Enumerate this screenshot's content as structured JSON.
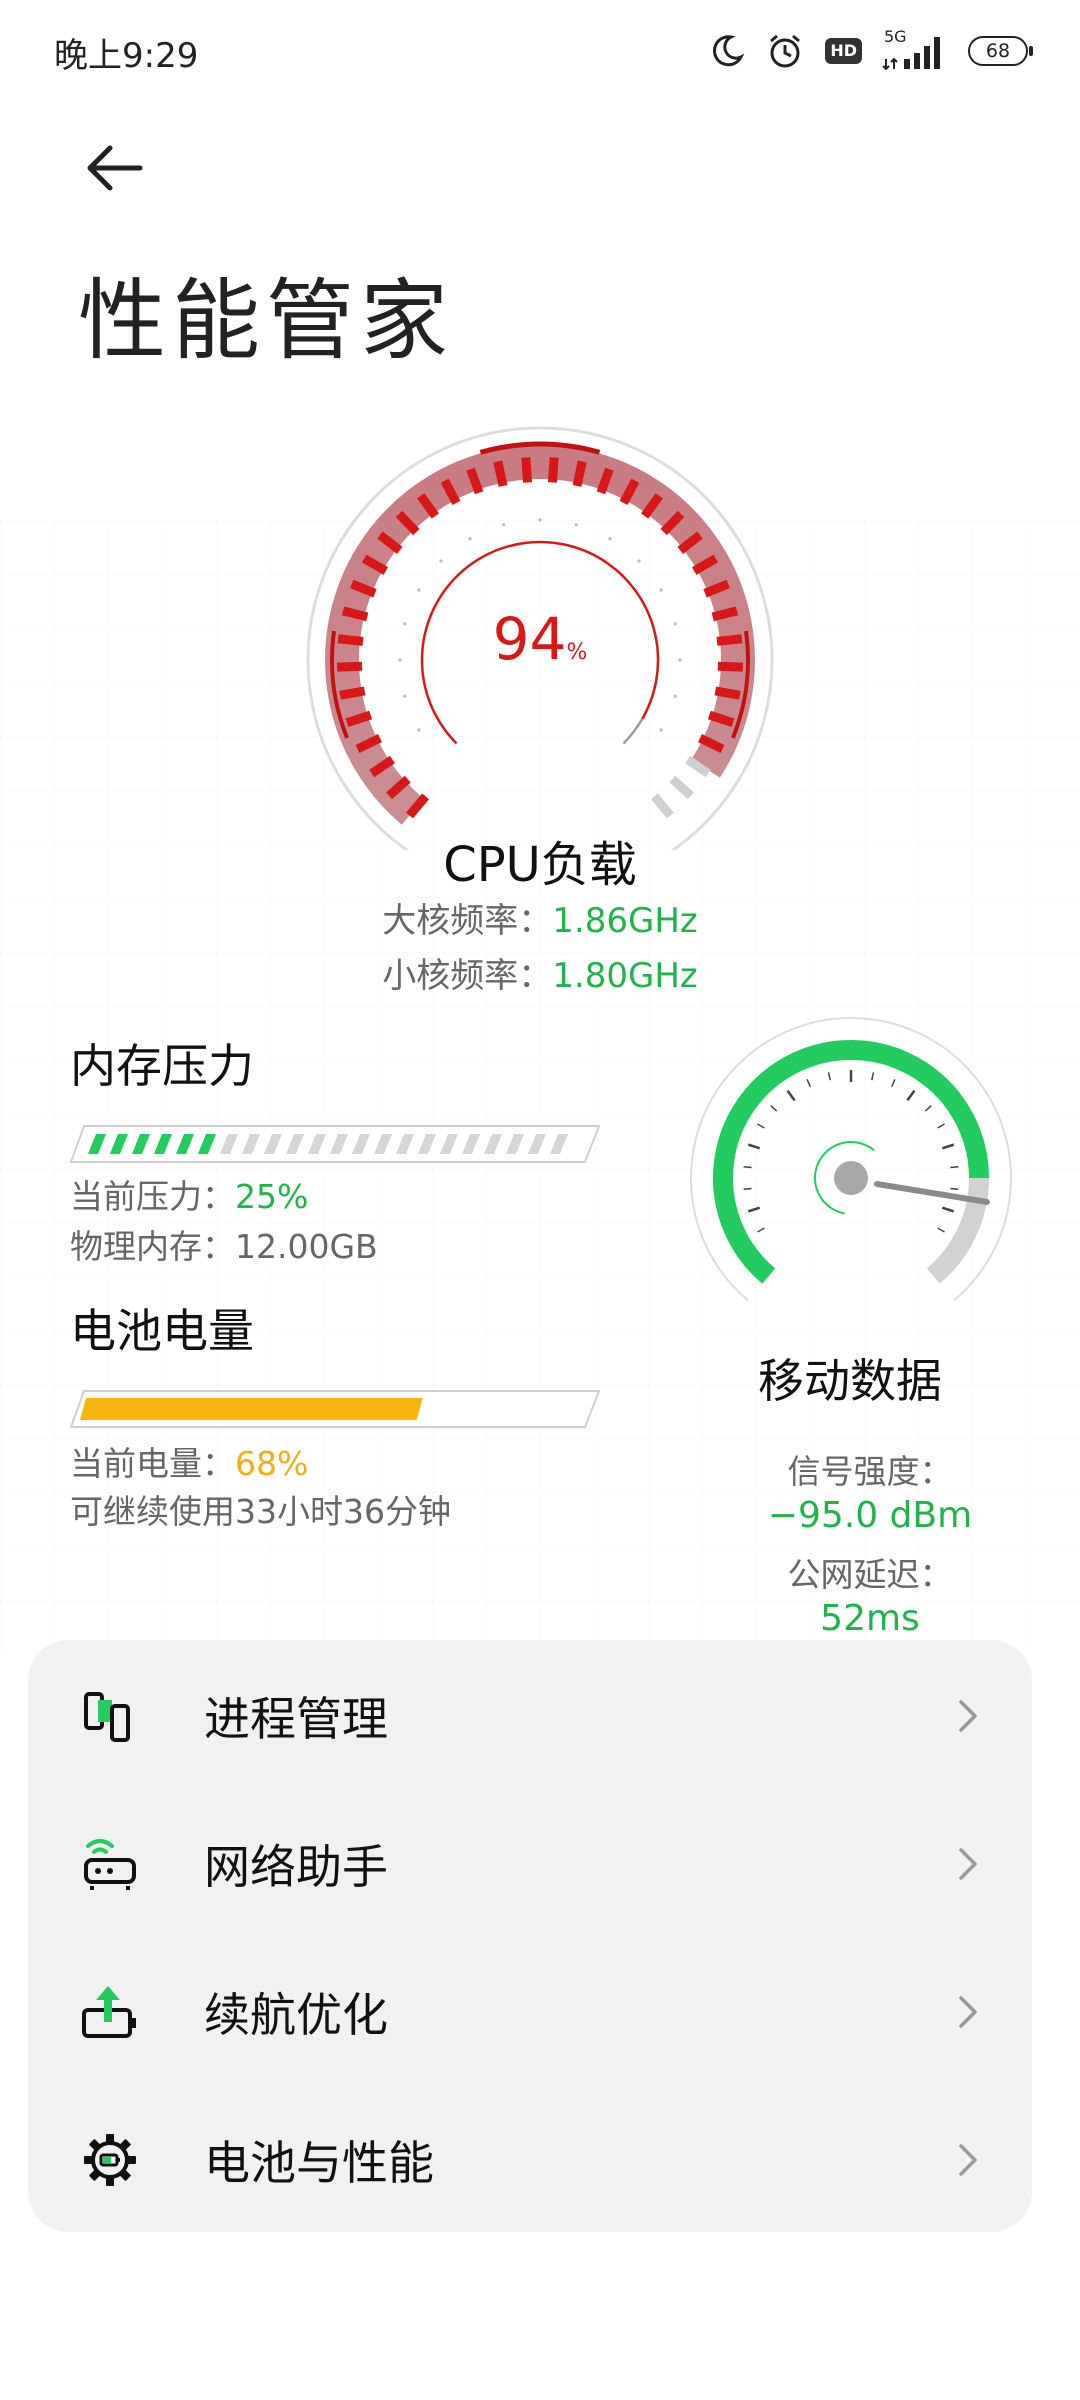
{
  "status_bar": {
    "time": "晚上9:29",
    "network_type": "5G",
    "hd_label": "HD",
    "battery_level": "68",
    "icons": [
      "moon-icon",
      "alarm-icon",
      "hd-icon",
      "signal-icon",
      "battery-icon"
    ]
  },
  "header": {
    "back_icon": "arrow-left-icon",
    "title": "性能管家"
  },
  "cpu": {
    "value": "94",
    "unit": "%",
    "load_fraction": 0.94,
    "label": "CPU负载",
    "big_core_label": "大核频率：",
    "big_core_value": "1.86GHz",
    "small_core_label": "小核频率：",
    "small_core_value": "1.80GHz",
    "color": "#d81818"
  },
  "memory": {
    "title": "内存压力",
    "pressure_fraction": 0.25,
    "pressure_label": "当前压力：",
    "pressure_value": "25%",
    "physical_label": "物理内存：",
    "physical_value": "12.00GB",
    "color": "#22cc5e"
  },
  "battery": {
    "title": "电池电量",
    "level_fraction": 0.68,
    "level_label": "当前电量：",
    "level_value": "68%",
    "remaining": "可继续使用33小时36分钟",
    "color": "#f8b40f"
  },
  "network": {
    "title": "移动数据",
    "signal_label": "信号强度：",
    "signal_value": "−95.0 dBm",
    "latency_label": "公网延迟：",
    "latency_value": "52ms",
    "color": "#22cc5e"
  },
  "menu": {
    "items": [
      {
        "label": "进程管理",
        "icon": "process-icon"
      },
      {
        "label": "网络助手",
        "icon": "router-icon"
      },
      {
        "label": "续航优化",
        "icon": "battery-boost-icon"
      },
      {
        "label": "电池与性能",
        "icon": "gear-icon"
      }
    ]
  }
}
